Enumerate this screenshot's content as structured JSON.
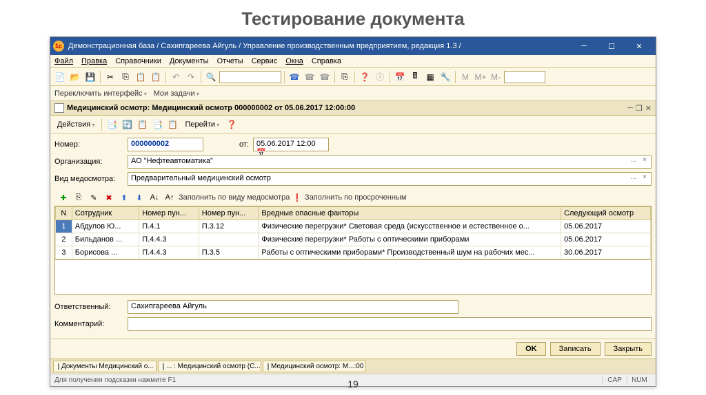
{
  "slide": {
    "title": "Тестирование документа",
    "number": "19"
  },
  "window": {
    "title": "Демонстрационная база / Сахипгареева Айгуль /  Управление производственным предприятием, редакция 1.3 /"
  },
  "menu": [
    "Файл",
    "Правка",
    "Справочники",
    "Документы",
    "Отчеты",
    "Сервис",
    "Окна",
    "Справка"
  ],
  "toolbar2": {
    "switch": "Переключить интерфейс",
    "tasks": "Мои задачи"
  },
  "doc": {
    "tab_title": "Медицинский осмотр: Медицинский осмотр 000000002 от 05.06.2017 12:00:00",
    "actions": "Действия",
    "goto": "Перейти"
  },
  "form": {
    "number_label": "Номер:",
    "number": "000000002",
    "from_label": "от:",
    "date": "05.06.2017 12:00",
    "org_label": "Организация:",
    "org": "АО \"Нефтеавтоматика\"",
    "type_label": "Вид медосмотра:",
    "type": "Предварительный медицинский осмотр",
    "resp_label": "Ответственный:",
    "resp": "Сахипгареева Айгуль",
    "comment_label": "Комментарий:",
    "comment": ""
  },
  "gridbar": {
    "fill_by_type": "Заполнить по виду медосмотра",
    "fill_overdue": "Заполнить по просроченным"
  },
  "grid": {
    "headers": {
      "n": "N",
      "emp": "Сотрудник",
      "p1": "Номер пун...",
      "p2": "Номер пун...",
      "factors": "Вредные опасные факторы",
      "next": "Следующий осмотр"
    },
    "rows": [
      {
        "n": "1",
        "emp": "Абдулов Ю...",
        "p1": "П.4.1",
        "p2": "П.3.12",
        "factors": "Физические перегрузки* Световая среда (искусственное и естественное о...",
        "next": "05.06.2017"
      },
      {
        "n": "2",
        "emp": "Бильданов ...",
        "p1": "П.4.4.3",
        "p2": "",
        "factors": "Физические перегрузки* Работы с оптическими приборами",
        "next": "05.06.2017"
      },
      {
        "n": "3",
        "emp": "Борисова ...",
        "p1": "П.4.4.3",
        "p2": "П.3.5",
        "factors": "Работы с оптическими приборами* Производственный шум на рабочих мес...",
        "next": "30.06.2017"
      }
    ]
  },
  "buttons": {
    "ok": "OK",
    "save": "Записать",
    "close": "Закрыть"
  },
  "tabs": [
    "Документы Медицинский о...",
    "... : Медицинский осмотр (С...",
    "Медицинский осмотр: М...:00"
  ],
  "status": {
    "hint": "Для получения подсказки нажмите F1",
    "cap": "CAP",
    "num": "NUM"
  }
}
